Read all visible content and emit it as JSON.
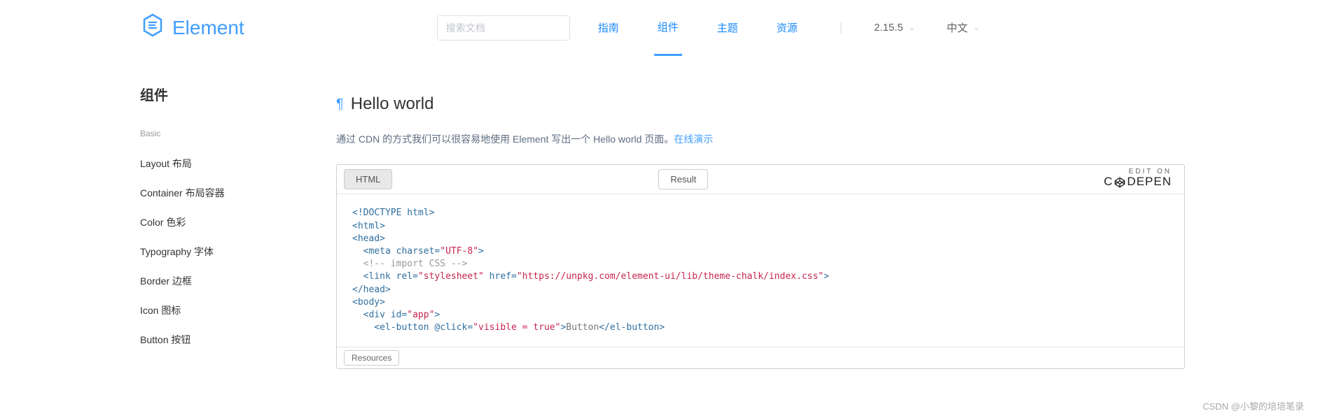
{
  "header": {
    "brand": "Element",
    "search_placeholder": "搜索文档",
    "nav": {
      "guide": "指南",
      "components": "组件",
      "theme": "主题",
      "resources": "资源"
    },
    "version": "2.15.5",
    "language": "中文"
  },
  "sidebar": {
    "title": "组件",
    "group_label": "Basic",
    "items": [
      "Layout 布局",
      "Container 布局容器",
      "Color 色彩",
      "Typography 字体",
      "Border 边框",
      "Icon 图标",
      "Button 按钮"
    ]
  },
  "main": {
    "heading": "Hello world",
    "description_prefix": "通过 CDN 的方式我们可以很容易地使用 Element 写出一个 Hello world 页面。",
    "demo_link": "在线演示"
  },
  "codepen": {
    "tab_html": "HTML",
    "tab_result": "Result",
    "edit_on_label": "EDIT ON",
    "brand_prefix": "C",
    "brand_suffix": "DEPEN",
    "resources_label": "Resources",
    "code": {
      "l1": "<!DOCTYPE html>",
      "l2": "<html>",
      "l3": "<head>",
      "l4_tag": "  <meta",
      "l4_attr": " charset=",
      "l4_val": "\"UTF-8\"",
      "l4_end": ">",
      "l5": "  <!-- import CSS -->",
      "l6_tag": "  <link",
      "l6_attr1": " rel=",
      "l6_val1": "\"stylesheet\"",
      "l6_attr2": " href=",
      "l6_val2": "\"https://unpkg.com/element-ui/lib/theme-chalk/index.css\"",
      "l6_end": ">",
      "l7": "</head>",
      "l8": "<body>",
      "l9_tag": "  <div",
      "l9_attr": " id=",
      "l9_val": "\"app\"",
      "l9_end": ">",
      "l10_tag1": "    <el-button",
      "l10_attr": " @click=",
      "l10_val": "\"visible = true\"",
      "l10_close": ">",
      "l10_text": "Button",
      "l10_tag2": "</el-button>"
    }
  },
  "watermark": "CSDN @小黎的培培笔录"
}
